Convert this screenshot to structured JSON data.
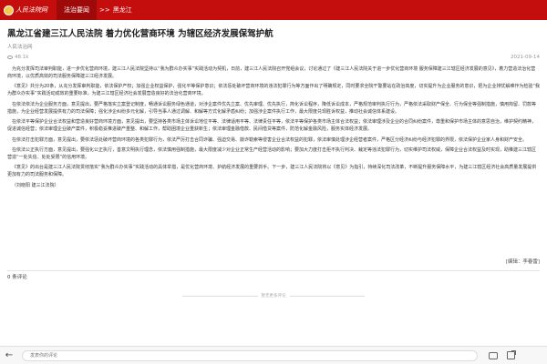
{
  "header": {
    "logo_text": "人民法院网",
    "nav_current": "法治要闻",
    "nav_separator": ">>",
    "nav_location": "黑龙江"
  },
  "article": {
    "title": "黑龙江省建三江人民法院 着力优化营商环境 为辖区经济发展保驾护航",
    "source": "人民法治网",
    "views": "48.1k",
    "date": "2021-09-14",
    "paragraphs": [
      "为充分发挥司法审判职能，进一步优化营商环境，建三江人民法院坚持以“我为群众办实事”实践活动为契机，日前，建三江人民法院召开党组会议，讨论通过了《建三江人民法院关于进一步优化营商环境 服务保障建三江辖区经济发展的意见》，着力营造法治化营商环境，以优质高效的司法服务保障建三江经济发展。",
      "《意见》共分为20条，从充分发挥审判职能，依法保护产权；加强企业权益保护，强化平等保护意识；依法惩处破坏营商环境的违法犯罪行为等方面作出了明确规定，同时要求全院干警要站在政治高度，切实提升为企业服务的意识，把为企业排忧解难作为检验“我为群众办实事”实践活动成效的重要标准，为建三江辖区经济社会发展营造良好的法治化营商环境。",
      "在依法依法为企业服务方面，意见提出，要严格落实立案登记制度，畅通诉讼服务绿色通道，对涉企案件优先立案、优先审理、优先执行，简化诉讼程序，降低诉讼成本，严格规范审判执行行为，严格依法采取财产保全、行为保全等强制措施，慎用拘留、罚款等措施，为企业经营发展提供有力的司法保障；强化涉企纠纷多元化解，引导当事人通过调解、和解等方式化解矛盾纠纷；加强涉企案件执行工作，最大限度兑现胜诉权益，推动社会诚信体系建设。",
      "在依法平等保护企业合法权益和营造良好营商环境方面，意见提出，要坚持各类市场主体诉讼地位平等、法律适用平等、法律责任平等，依法平等保护各类市场主体合法权益；依法审理涉及企业的合同纠纷案件，尊重和保护市场主体的意思自治，维护契约精神，促进诚信经营；依法审理企业破产案件，积极稳妥推进破产重整、和解工作，帮助困境企业重获新生；依法审理金融借款、民间借贷等案件，防范化解金融风险，服务实体经济发展。",
      "在依法打击犯罪方面，意见提出，要依法惩处破坏营商环境的各类犯罪行为，依法严厉打击合同诈骗、强迫交易、敲诈勒索等侵害企业合法权益的犯罪，依法审慎处理涉企经营者案件，严格区分经济纠纷与经济犯罪的界限，依法保护企业家人身和财产安全。",
      "在依法公正执行方面，意见提出，要强化公正执行，善意文明执行理念，依法慎用强制措施，最大限度减少对企业正常生产经营活动的影响；要加大力度打击拒不执行判决、裁定等违法犯罪行为，切实维护司法权威，保障企业合法权益及时实现，助推建三江辖区营造“一处失信、处处受限”的信用环境。",
      "《意见》的出台是建三江人民法院贯彻落实“我为群众办实事”实践活动的具体举措，是优化营商环境、护航经济发展的重要抓手。下一步，建三江人民法院将以《意见》为指引，持续深化司法改革，不断提升服务保障水平，为建三江辖区经济社会高质量发展提供更加有力的司法服务和保障。",
      "（刘晓阳 建三江法院）"
    ],
    "editor": "[编辑：李春雷]"
  },
  "comments": {
    "heading": "0 条评论",
    "empty_text": "暂无更多评论"
  },
  "bottombar": {
    "input_placeholder": "发表你的评论"
  }
}
